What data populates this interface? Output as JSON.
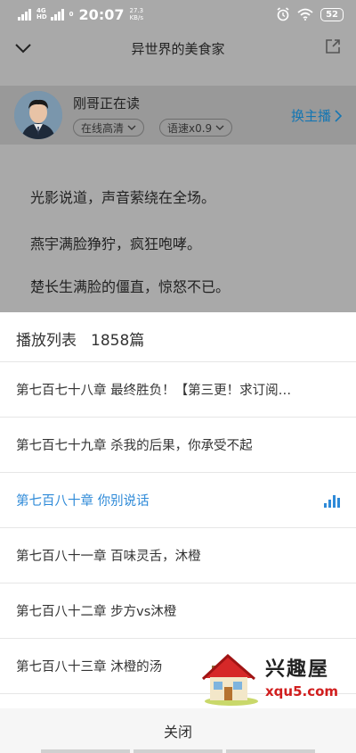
{
  "status_bar": {
    "network": "4G",
    "network_sub": "HD",
    "signal2": "0",
    "time": "20:07",
    "speed_value": "27.3",
    "speed_unit": "KB/s",
    "battery": "52"
  },
  "nav": {
    "title": "异世界的美食家",
    "back_icon": "chevron-down-icon",
    "share_icon": "share-icon"
  },
  "reader": {
    "name": "刚哥正在读",
    "quality": "在线高清",
    "speed": "语速x0.9",
    "switch_label": "换主播"
  },
  "content": {
    "lines": [
      "光影说道，声音萦绕在全场。",
      "燕宇满脸狰狞，疯狂咆哮。",
      "楚长生满脸的僵直，惊怒不已。"
    ]
  },
  "playlist": {
    "title": "播放列表",
    "count": "1858篇",
    "chapters": [
      {
        "label": "第七百七十八章 最终胜负！【第三更！求订阅…",
        "active": false
      },
      {
        "label": "第七百七十九章 杀我的后果，你承受不起",
        "active": false
      },
      {
        "label": "第七百八十章 你别说话",
        "active": true
      },
      {
        "label": "第七百八十一章 百味灵舌，沐橙",
        "active": false
      },
      {
        "label": "第七百八十二章 步方vs沐橙",
        "active": false
      },
      {
        "label": "第七百八十三章 沐橙的汤",
        "active": false
      }
    ],
    "close_label": "关闭"
  },
  "watermark": {
    "name": "兴趣屋",
    "url": "xqu5.com"
  },
  "colors": {
    "accent": "#2e8ad8",
    "link": "#1476b3",
    "overlay": "#a9a9a9"
  }
}
